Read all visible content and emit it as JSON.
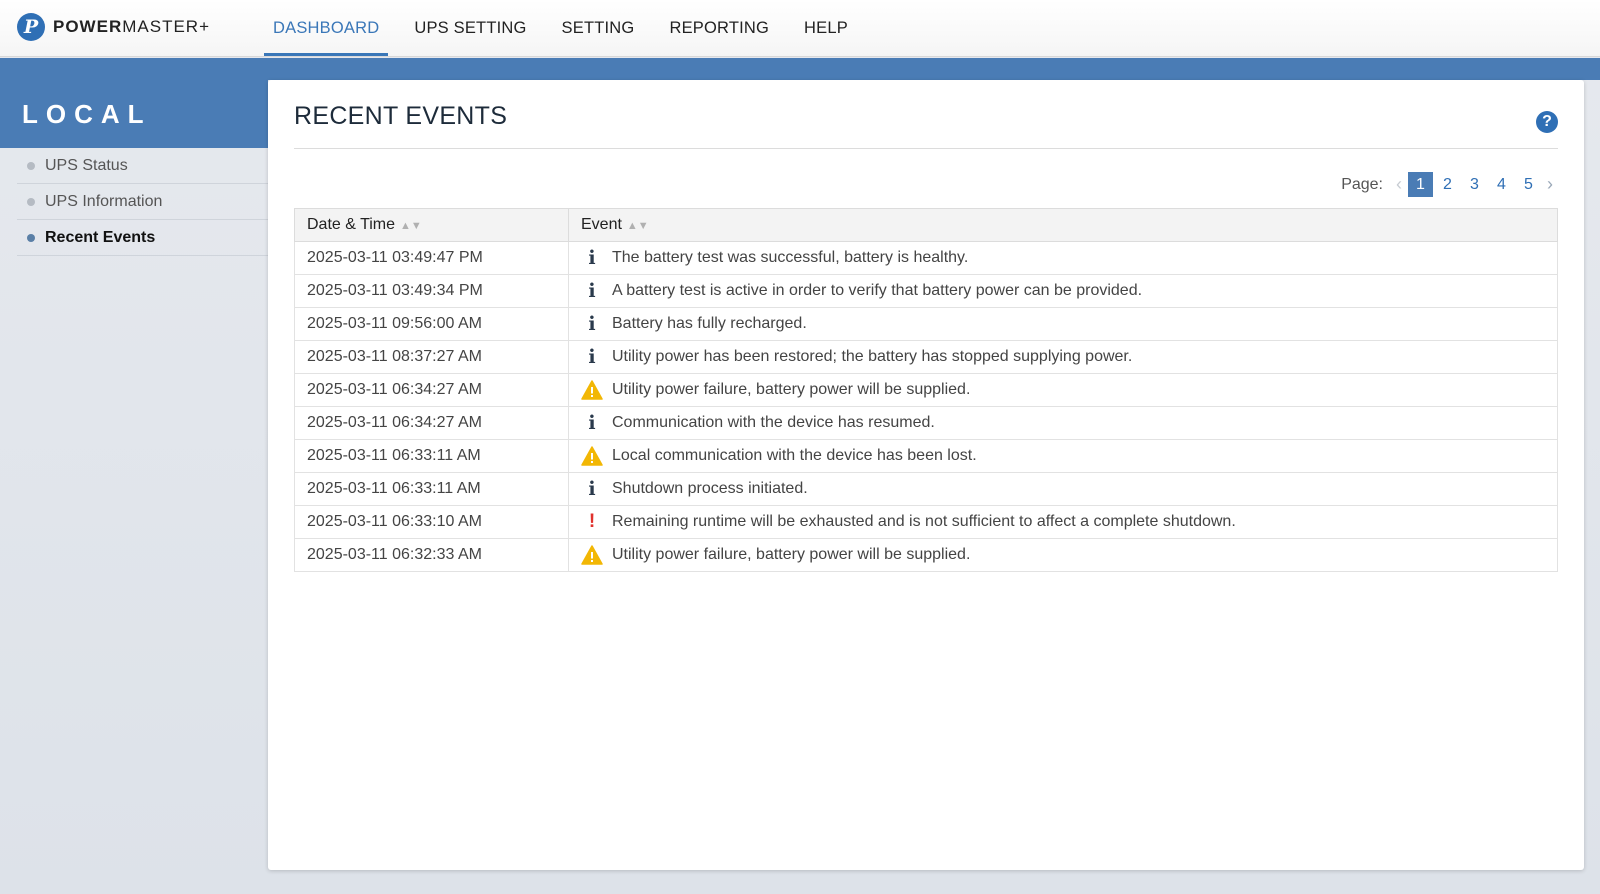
{
  "app": {
    "logo_mark": "P",
    "logo_bold": "POWER",
    "logo_rest": "MASTER+"
  },
  "nav": {
    "items": [
      {
        "label": "DASHBOARD",
        "active": true
      },
      {
        "label": "UPS SETTING",
        "active": false
      },
      {
        "label": "SETTING",
        "active": false
      },
      {
        "label": "REPORTING",
        "active": false
      },
      {
        "label": "HELP",
        "active": false
      }
    ]
  },
  "sidebar": {
    "title": "LOCAL",
    "items": [
      {
        "label": "UPS Status",
        "active": false
      },
      {
        "label": "UPS Information",
        "active": false
      },
      {
        "label": "Recent Events",
        "active": true
      }
    ]
  },
  "main": {
    "title": "RECENT EVENTS",
    "help_icon": "question-icon",
    "pager": {
      "label": "Page:",
      "pages": [
        "1",
        "2",
        "3",
        "4",
        "5"
      ],
      "current": "1"
    },
    "table": {
      "columns": [
        "Date & Time",
        "Event"
      ],
      "rows": [
        {
          "datetime": "2025-03-11 03:49:47 PM",
          "severity": "info",
          "event": "The battery test was successful, battery is healthy."
        },
        {
          "datetime": "2025-03-11 03:49:34 PM",
          "severity": "info",
          "event": "A battery test is active in order to verify that battery power can be provided."
        },
        {
          "datetime": "2025-03-11 09:56:00 AM",
          "severity": "info",
          "event": "Battery has fully recharged."
        },
        {
          "datetime": "2025-03-11 08:37:27 AM",
          "severity": "info",
          "event": "Utility power has been restored; the battery has stopped supplying power."
        },
        {
          "datetime": "2025-03-11 06:34:27 AM",
          "severity": "warning",
          "event": "Utility power failure, battery power will be supplied."
        },
        {
          "datetime": "2025-03-11 06:34:27 AM",
          "severity": "info",
          "event": "Communication with the device has resumed."
        },
        {
          "datetime": "2025-03-11 06:33:11 AM",
          "severity": "warning",
          "event": "Local communication with the device has been lost."
        },
        {
          "datetime": "2025-03-11 06:33:11 AM",
          "severity": "info",
          "event": "Shutdown process initiated."
        },
        {
          "datetime": "2025-03-11 06:33:10 AM",
          "severity": "critical",
          "event": "Remaining runtime will be exhausted and is not sufficient to affect a complete shutdown."
        },
        {
          "datetime": "2025-03-11 06:32:33 AM",
          "severity": "warning",
          "event": "Utility power failure, battery power will be supplied."
        }
      ]
    }
  },
  "colors": {
    "brand_blue": "#4a7cb5",
    "link_blue": "#2f6fb5",
    "warning_yellow": "#f2b705",
    "critical_red": "#e0322d"
  }
}
